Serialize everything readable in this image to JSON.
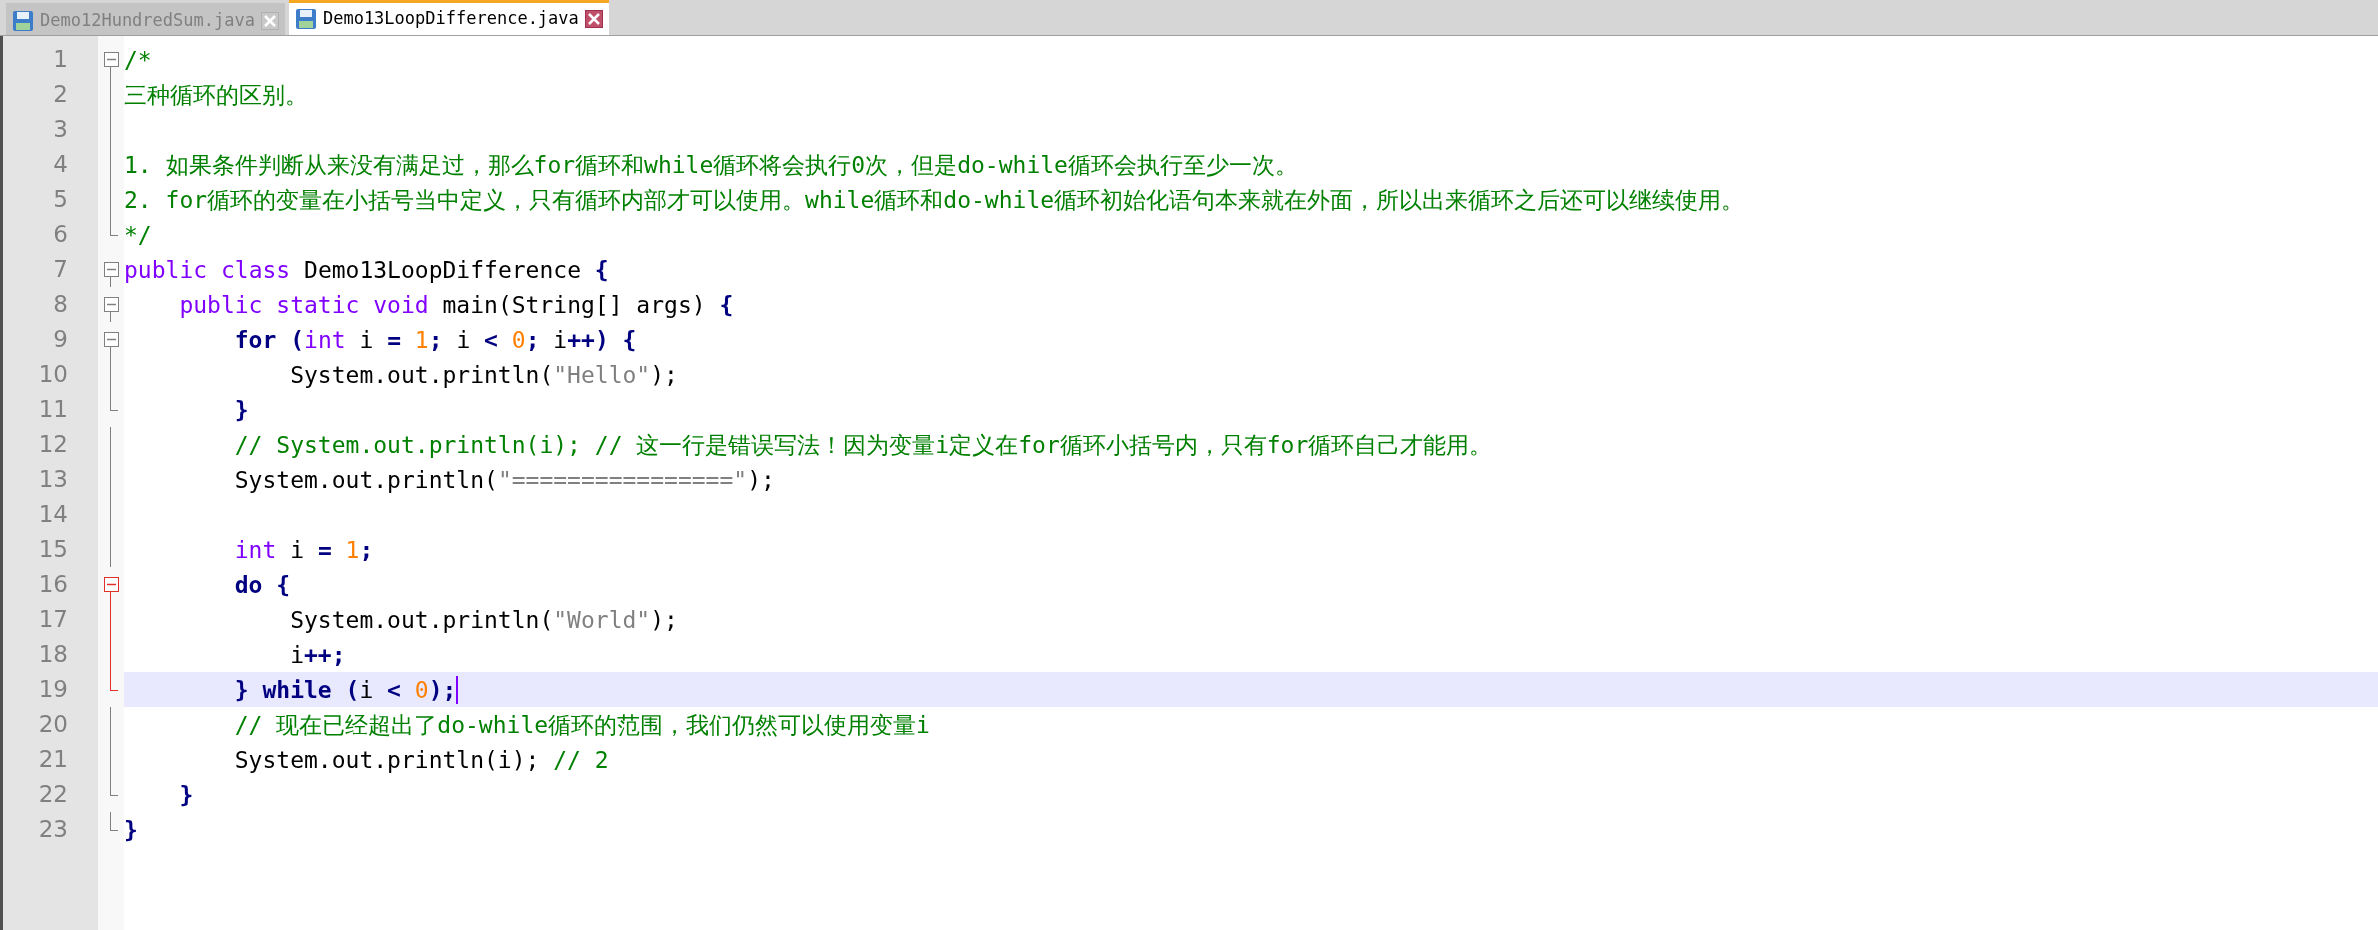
{
  "tabs": [
    {
      "label": "Demo12HundredSum.java",
      "selected": false
    },
    {
      "label": "Demo13LoopDifference.java",
      "selected": true
    }
  ],
  "lines": [
    {
      "number": "1",
      "fold": {
        "kind": "start",
        "active": false
      },
      "current": false,
      "tokens": [
        {
          "kind": "cmt",
          "t": "/*"
        }
      ]
    },
    {
      "number": "2",
      "fold": {
        "kind": "mid",
        "active": false
      },
      "current": false,
      "tokens": [
        {
          "kind": "cmt",
          "t": "三种循环的区别。"
        }
      ]
    },
    {
      "number": "3",
      "fold": {
        "kind": "mid",
        "active": false
      },
      "current": false
    },
    {
      "number": "4",
      "fold": {
        "kind": "mid",
        "active": false
      },
      "current": false,
      "tokens": [
        {
          "kind": "cmt",
          "t": "1. 如果条件判断从来没有满足过，那么for循环和while循环将会执行0次，但是do-while循环会执行至少一次。"
        }
      ]
    },
    {
      "number": "5",
      "fold": {
        "kind": "mid",
        "active": false
      },
      "current": false,
      "tokens": [
        {
          "kind": "cmt",
          "t": "2. for循环的变量在小括号当中定义，只有循环内部才可以使用。while循环和do-while循环初始化语句本来就在外面，所以出来循环之后还可以继续使用。"
        }
      ]
    },
    {
      "number": "6",
      "fold": {
        "kind": "end",
        "active": false
      },
      "current": false,
      "tokens": [
        {
          "kind": "cmt",
          "t": "*/"
        }
      ]
    },
    {
      "number": "7",
      "fold": {
        "kind": "start",
        "active": false
      },
      "current": false,
      "tokens": [
        {
          "kind": "type",
          "t": "public "
        },
        {
          "kind": "type",
          "t": "class"
        },
        {
          "kind": "txt",
          "t": " Demo13LoopDifference "
        },
        {
          "kind": "op",
          "t": "{"
        }
      ]
    },
    {
      "number": "8",
      "fold": {
        "kind": "start",
        "active": false
      },
      "current": false,
      "tokens": [
        {
          "kind": "type",
          "t": "    public "
        },
        {
          "kind": "type",
          "t": "static "
        },
        {
          "kind": "type",
          "t": "void"
        },
        {
          "kind": "txt",
          "t": " main(String[] args) "
        },
        {
          "kind": "op",
          "t": "{"
        }
      ]
    },
    {
      "number": "9",
      "fold": {
        "kind": "start",
        "active": false
      },
      "current": false,
      "tokens": [
        {
          "kind": "kw",
          "t": "        for "
        },
        {
          "kind": "op",
          "t": "("
        },
        {
          "kind": "type",
          "t": "int"
        },
        {
          "kind": "txt",
          "t": " i "
        },
        {
          "kind": "op",
          "t": "= "
        },
        {
          "kind": "num",
          "t": "1"
        },
        {
          "kind": "op",
          "t": ";"
        },
        {
          "kind": "txt",
          "t": " i "
        },
        {
          "kind": "op",
          "t": "< "
        },
        {
          "kind": "num",
          "t": "0"
        },
        {
          "kind": "op",
          "t": ";"
        },
        {
          "kind": "txt",
          "t": " i"
        },
        {
          "kind": "op",
          "t": "++) {"
        }
      ]
    },
    {
      "number": "10",
      "fold": {
        "kind": "mid",
        "active": false
      },
      "current": false,
      "tokens": [
        {
          "kind": "txt",
          "t": "            System.out.println("
        },
        {
          "kind": "str",
          "t": "\"Hello\""
        },
        {
          "kind": "txt",
          "t": ");"
        }
      ]
    },
    {
      "number": "11",
      "fold": {
        "kind": "end",
        "active": false
      },
      "current": false,
      "tokens": [
        {
          "kind": "op",
          "t": "        }"
        }
      ]
    },
    {
      "number": "12",
      "fold": {
        "kind": "mid",
        "active": false
      },
      "current": false,
      "tokens": [
        {
          "kind": "cmt",
          "t": "        // System.out.println(i); // 这一行是错误写法！因为变量i定义在for循环小括号内，只有for循环自己才能用。"
        }
      ]
    },
    {
      "number": "13",
      "fold": {
        "kind": "mid",
        "active": false
      },
      "current": false,
      "tokens": [
        {
          "kind": "txt",
          "t": "        System.out.println("
        },
        {
          "kind": "str",
          "t": "\"================\""
        },
        {
          "kind": "txt",
          "t": ");"
        }
      ]
    },
    {
      "number": "14",
      "fold": {
        "kind": "mid",
        "active": false
      },
      "current": false
    },
    {
      "number": "15",
      "fold": {
        "kind": "mid",
        "active": false
      },
      "current": false,
      "tokens": [
        {
          "kind": "type",
          "t": "        int"
        },
        {
          "kind": "txt",
          "t": " i "
        },
        {
          "kind": "op",
          "t": "= "
        },
        {
          "kind": "num",
          "t": "1"
        },
        {
          "kind": "op",
          "t": ";"
        }
      ]
    },
    {
      "number": "16",
      "fold": {
        "kind": "start",
        "active": true
      },
      "current": false,
      "tokens": [
        {
          "kind": "kw",
          "t": "        do {"
        }
      ]
    },
    {
      "number": "17",
      "fold": {
        "kind": "mid",
        "active": true
      },
      "current": false,
      "tokens": [
        {
          "kind": "txt",
          "t": "            System.out.println("
        },
        {
          "kind": "str",
          "t": "\"World\""
        },
        {
          "kind": "txt",
          "t": ");"
        }
      ]
    },
    {
      "number": "18",
      "fold": {
        "kind": "mid",
        "active": true
      },
      "current": false,
      "tokens": [
        {
          "kind": "txt",
          "t": "            i"
        },
        {
          "kind": "op",
          "t": "++;"
        }
      ]
    },
    {
      "number": "19",
      "fold": {
        "kind": "end",
        "active": true
      },
      "current": true,
      "tokens": [
        {
          "kind": "kw",
          "t": "        } while ("
        },
        {
          "kind": "txt",
          "t": "i "
        },
        {
          "kind": "op",
          "t": "< "
        },
        {
          "kind": "num",
          "t": "0"
        },
        {
          "kind": "op",
          "t": ");"
        }
      ]
    },
    {
      "number": "20",
      "fold": {
        "kind": "mid",
        "active": false
      },
      "current": false,
      "tokens": [
        {
          "kind": "cmt",
          "t": "        // 现在已经超出了do-while循环的范围，我们仍然可以使用变量i"
        }
      ]
    },
    {
      "number": "21",
      "fold": {
        "kind": "mid",
        "active": false
      },
      "current": false,
      "tokens": [
        {
          "kind": "txt",
          "t": "        System.out.println(i); "
        },
        {
          "kind": "cmt",
          "t": "// 2"
        }
      ]
    },
    {
      "number": "22",
      "fold": {
        "kind": "end",
        "active": false
      },
      "current": false,
      "tokens": [
        {
          "kind": "op",
          "t": "    }"
        }
      ]
    },
    {
      "number": "23",
      "fold": {
        "kind": "end",
        "active": false
      },
      "current": false,
      "tokens": [
        {
          "kind": "op",
          "t": "}"
        }
      ]
    }
  ]
}
